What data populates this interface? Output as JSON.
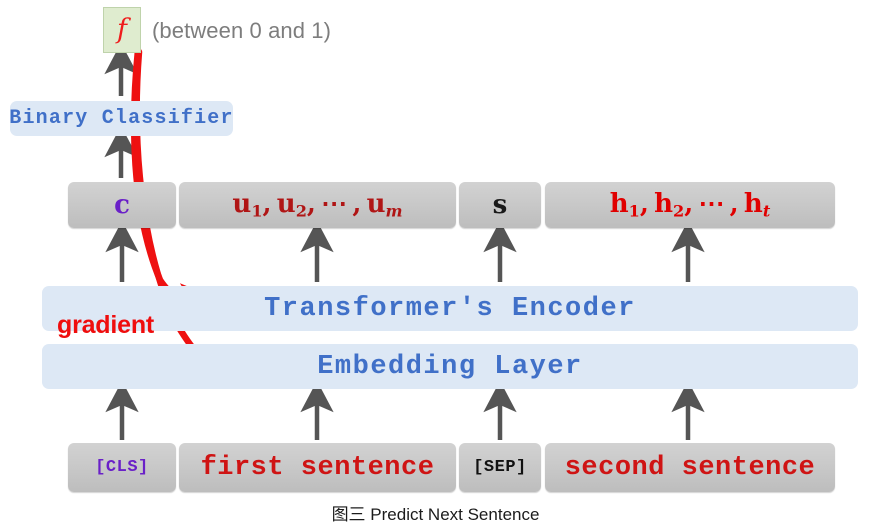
{
  "figure": {
    "caption": "图三 Predict Next Sentence",
    "output_note": "(between 0 and 1)",
    "output_symbol": "f",
    "gradient_label": "gradient"
  },
  "layers": {
    "classifier": "Binary Classifier",
    "encoder": "Transformer's Encoder",
    "embedding": "Embedding Layer"
  },
  "outputs": [
    {
      "id": "c",
      "text": "c",
      "color": "#6a20c8"
    },
    {
      "id": "u",
      "text": "u1, u2, ⋯, um",
      "color": "#b01515"
    },
    {
      "id": "s",
      "text": "s",
      "color": "#1a1a1a"
    },
    {
      "id": "h",
      "text": "h1, h2, ⋯, ht",
      "color": "#e00000"
    }
  ],
  "inputs": [
    {
      "id": "cls",
      "text": "[CLS]",
      "color": "#6a20c8"
    },
    {
      "id": "first",
      "text": "first sentence",
      "color": "#cf1414"
    },
    {
      "id": "sep",
      "text": "[SEP]",
      "color": "#111111"
    },
    {
      "id": "second",
      "text": "second sentence",
      "color": "#cf1414"
    }
  ],
  "colors": {
    "pill_background": "#dde8f5",
    "pill_text": "#4070c8",
    "box_background": "#c9c9c9",
    "arrow_gray": "#555555",
    "gradient_red": "#ef0d0d",
    "f_box_fill": "#dfeccf",
    "page_background": "#ffffff"
  }
}
